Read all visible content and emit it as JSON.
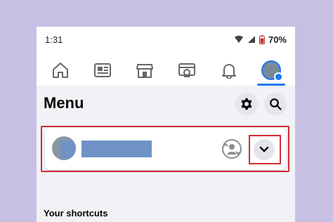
{
  "status_bar": {
    "time": "1:31",
    "battery_percent": "70%",
    "icons": [
      "wifi-icon",
      "signal-icon",
      "battery-icon"
    ]
  },
  "nav": {
    "items": [
      {
        "name": "home-icon"
      },
      {
        "name": "news-icon"
      },
      {
        "name": "marketplace-icon"
      },
      {
        "name": "watch-icon"
      },
      {
        "name": "notifications-icon"
      },
      {
        "name": "profile-menu-icon",
        "active": true
      }
    ]
  },
  "menu": {
    "title": "Menu",
    "settings_icon": "gear-icon",
    "search_icon": "search-icon",
    "shortcuts_label": "Your shortcuts"
  },
  "profile_card": {
    "switch_icon": "account-switch-icon",
    "chevron_icon": "chevron-down-icon"
  },
  "colors": {
    "brand": "#1877f2",
    "highlight": "#d12b34",
    "background": "#c8c0e4"
  }
}
